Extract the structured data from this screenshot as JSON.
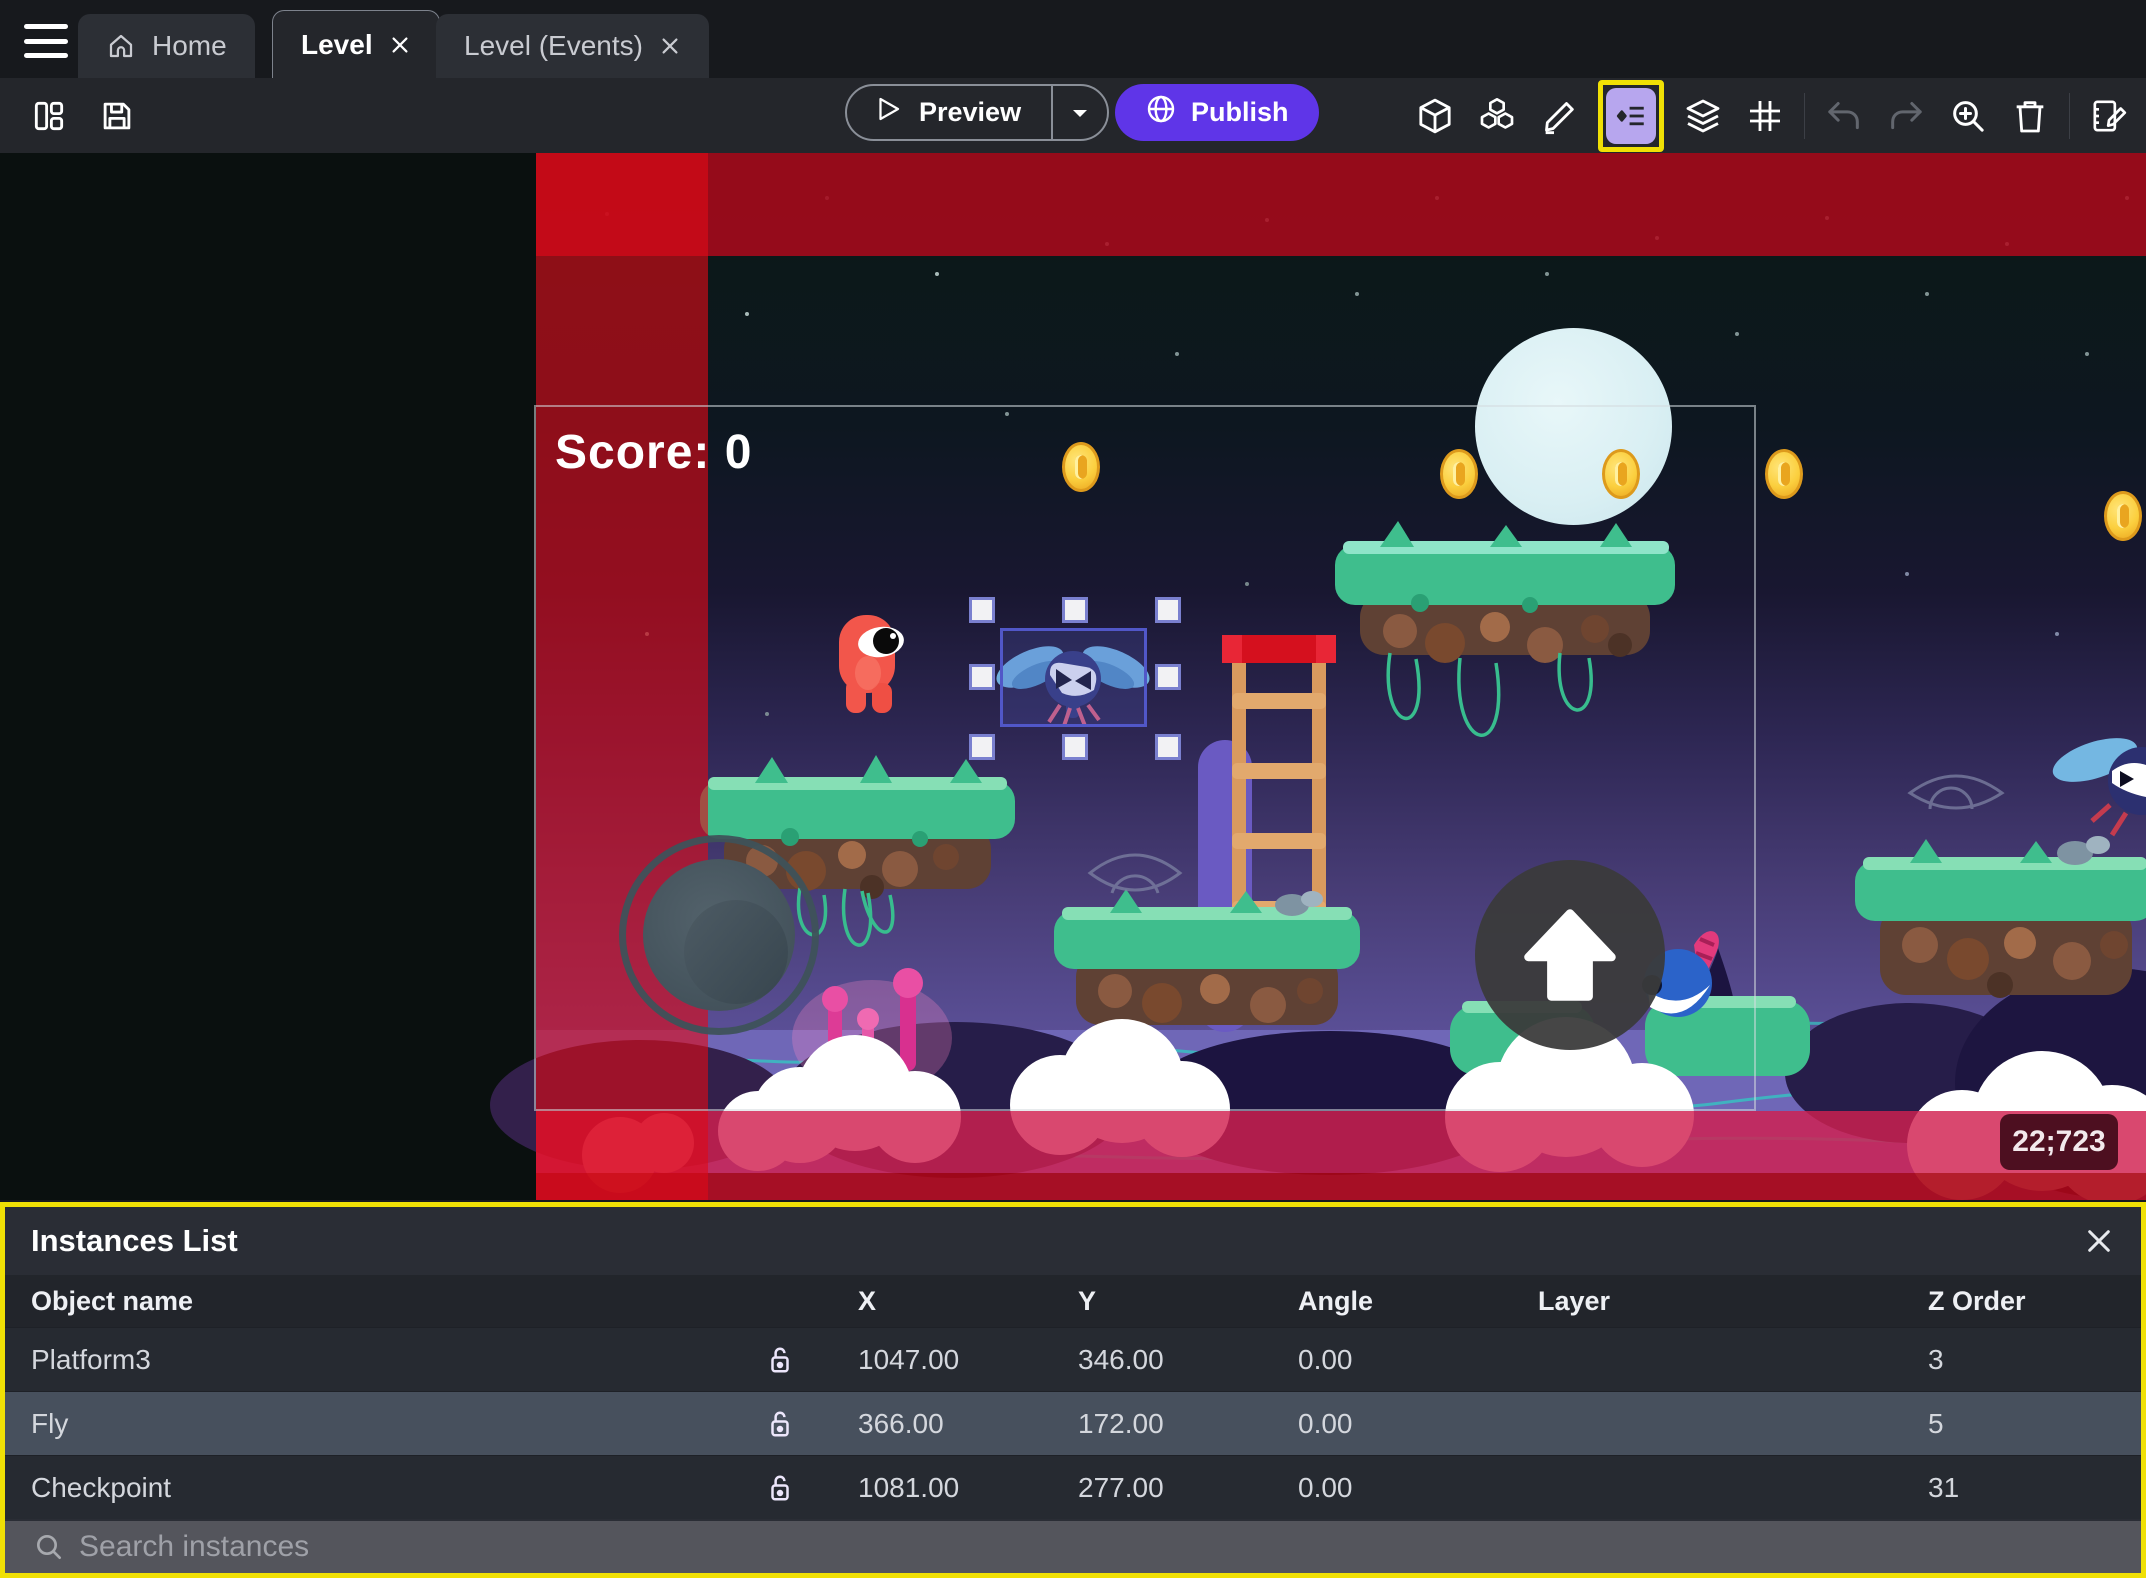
{
  "window": {
    "tabs": [
      {
        "label": "Home",
        "active": false
      },
      {
        "label": "Level",
        "active": true
      },
      {
        "label": "Level (Events)",
        "active": false
      }
    ]
  },
  "toolbar": {
    "preview_label": "Preview",
    "publish_label": "Publish",
    "icons": [
      "panels-layout-icon",
      "save-icon",
      "objects-cube-icon",
      "object-groups-icon",
      "edit-pencil-icon",
      "instances-list-icon",
      "layers-icon",
      "grid-icon",
      "undo-icon",
      "redo-icon",
      "zoom-in-icon",
      "delete-trash-icon",
      "edit-scene-properties-icon"
    ],
    "highlighted_icon": "instances-list-icon"
  },
  "scene": {
    "score_text": "Score: 0",
    "cursor_coordinates": "22;723",
    "selected_instance": "Fly",
    "sprites": [
      "player",
      "fly-enemy",
      "coins",
      "platforms",
      "ladder",
      "moon",
      "virtual-joystick",
      "jump-button",
      "checkpoint-monster"
    ]
  },
  "instances_panel": {
    "title": "Instances List",
    "columns": [
      "Object name",
      "X",
      "Y",
      "Angle",
      "Layer",
      "Z Order"
    ],
    "rows": [
      {
        "name": "Platform3",
        "x": "1047.00",
        "y": "346.00",
        "angle": "0.00",
        "layer": "",
        "z_order": "3",
        "selected": false
      },
      {
        "name": "Fly",
        "x": "366.00",
        "y": "172.00",
        "angle": "0.00",
        "layer": "",
        "z_order": "5",
        "selected": true
      },
      {
        "name": "Checkpoint",
        "x": "1081.00",
        "y": "277.00",
        "angle": "0.00",
        "layer": "",
        "z_order": "31",
        "selected": false
      }
    ],
    "search_placeholder": "Search instances"
  },
  "colors": {
    "publish_button": "#5f35e8",
    "annotation_highlight": "#f0e005",
    "instances_icon_bg": "#b7a6ee",
    "selection_outline": "#5157c8",
    "level_border_red": "#c00d1d",
    "selected_row_bg": "#47505d",
    "tab_bar_bg": "#17191d",
    "toolbar_bg": "#24262b",
    "panel_bg": "#2a2d35"
  }
}
